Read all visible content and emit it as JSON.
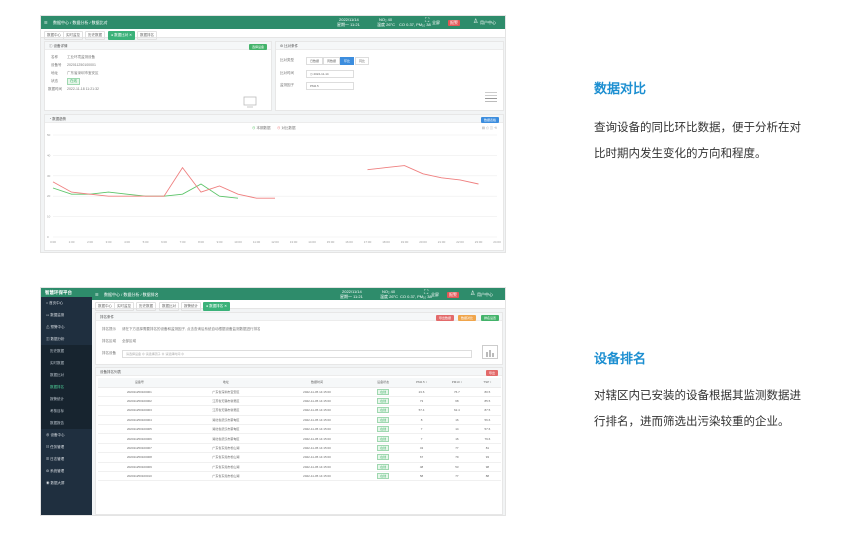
{
  "screen1": {
    "topbar": {
      "breadcrumb": "数据中心 / 数据分析 / 数据比对",
      "time1": "2022/11/14",
      "time2": "星期一 11:21",
      "metric1": "NO₂ 40",
      "metric2": "温度 26°C",
      "metric3": "CO 0.37, PM₁₀ 38",
      "fullscreen": "全屏",
      "alert": "报警",
      "user": "用户中心"
    },
    "tabs": [
      "数据中心",
      "实时监控",
      "历史数据",
      "数据比对",
      "数据排名"
    ],
    "active_tab": "数据比对",
    "device_panel": {
      "title": "设备详情",
      "button": "选择设备",
      "fields": [
        {
          "k": "名称",
          "v": "工业环境监测设备"
        },
        {
          "k": "设备号",
          "v": "202011250100001"
        },
        {
          "k": "地址",
          "v": "广东省深圳市宝安区"
        },
        {
          "k": "状态",
          "v": "在线"
        },
        {
          "k": "数据时间",
          "v": "2022-11-18 11:21:32"
        }
      ]
    },
    "compare_panel": {
      "title": "比对条件",
      "row1_label": "比对类型",
      "types": [
        "日数据",
        "周数据",
        "环比",
        "同比"
      ],
      "active_type": "环比",
      "row2_label": "比对时间",
      "date": "2022-11-14",
      "row3_label": "监测因子",
      "factor": "PM2.5",
      "legend_a": "本期数据",
      "legend_b": "对比数据"
    },
    "chart_panel": {
      "title": "数据趋势",
      "button": "数据表格"
    },
    "chart_data": {
      "type": "line",
      "title": "",
      "xlabel": "",
      "ylabel": "",
      "ylim": [
        0,
        50
      ],
      "yticks": [
        "50",
        "40",
        "30",
        "20",
        "10",
        "0"
      ],
      "x": [
        "0:00",
        "1:00",
        "2:00",
        "3:00",
        "4:00",
        "5:00",
        "6:00",
        "7:00",
        "8:00",
        "9:00",
        "10:00",
        "11:00",
        "12:00",
        "13:00",
        "14:00",
        "15:00",
        "16:00",
        "17:00",
        "18:00",
        "19:00",
        "20:00",
        "21:00",
        "22:00",
        "23:00",
        "24:00"
      ],
      "series": [
        {
          "name": "本期数据",
          "color": "#5cc469",
          "values": [
            24,
            21,
            21,
            22,
            21,
            20,
            20,
            21,
            26,
            20,
            19,
            null,
            null,
            null,
            null,
            null,
            null,
            null,
            null,
            null,
            null,
            null,
            null,
            null,
            null
          ]
        },
        {
          "name": "对比数据",
          "color": "#ef7f7f",
          "values": [
            27,
            22,
            21,
            20,
            20,
            20,
            20,
            34,
            22,
            25,
            21,
            19,
            19,
            null,
            null,
            null,
            null,
            33,
            34,
            35,
            31,
            29,
            28,
            26,
            null
          ]
        }
      ]
    }
  },
  "screen2": {
    "logo": "智慧环保平台",
    "topbar": {
      "breadcrumb": "数据中心 / 数据分析 / 数据排名",
      "time1": "2022/11/14",
      "time2": "星期一 11:21",
      "metric1": "NO₂ 40",
      "metric2": "温度 26°C",
      "metric3": "CO 0.37, PM₁₀ 38",
      "fullscreen": "全屏",
      "alert": "报警",
      "user": "用户中心"
    },
    "menu": [
      "首页中心",
      "数据监测",
      "预警中心",
      "数据分析"
    ],
    "submenu": [
      "历史数据",
      "实时数据",
      "数据比对",
      "数据排名",
      "报警统计",
      "考核目标",
      "数据报告"
    ],
    "active_submenu": "数据排名",
    "menu_bottom": [
      "设备中心",
      "任务管理",
      "日志管理",
      "系统管理",
      "数据大屏"
    ],
    "tabs": [
      "数据中心",
      "实时监控",
      "历史数据",
      "数据比对",
      "报警统计",
      "数据排名"
    ],
    "active_tab": "数据排名",
    "filter": {
      "title": "排名条件",
      "buttons": [
        "导出数据",
        "数据对比",
        "排名设置"
      ],
      "hint_label": "排名提示",
      "hint": "请在下方选择需要排名的设备和监测因子, 点击查询后系统自动根据设备监测数据进行排名",
      "area_label": "排名区域",
      "area": "全部区域",
      "device_label": "排名设备",
      "device_placeholder": "请选择设备 ⊗  请选择因子 ⊗  请选择时间 ⊗"
    },
    "table": {
      "title": "设备排名列表",
      "button": "导出",
      "headers": [
        "设备号",
        "地址",
        "数据时间",
        "设备状态",
        "PM2.5 ↕",
        "PM10 ↕",
        "TSP ↕"
      ],
      "rows": [
        [
          "202011250100001",
          "广东省深圳市宝安区",
          "2022-11-05 14:15:00",
          "在线",
          "23.6",
          "76.7",
          "80.5"
        ],
        [
          "202011250100002",
          "江苏省无锡市新吴区",
          "2022-11-05 14:15:00",
          "在线",
          "73",
          "68",
          "85.5"
        ],
        [
          "202011250100003",
          "江苏省无锡市新吴区",
          "2022-11-05 14:15:00",
          "在线",
          "57.4",
          "62.4",
          "87.5"
        ],
        [
          "202011250100004",
          "湖北省武汉市蔡甸区",
          "2022-11-05 14:15:00",
          "在线",
          "8",
          "16",
          "56.6"
        ],
        [
          "202011250100005",
          "湖北省武汉市蔡甸区",
          "2022-11-05 14:15:00",
          "在线",
          "7",
          "14",
          "57.6"
        ],
        [
          "202011250100006",
          "湖北省武汉市蔡甸区",
          "2022-11-05 14:15:00",
          "在线",
          "7",
          "16",
          "79.6"
        ],
        [
          "202011250100007",
          "广东省东莞市松山湖",
          "2022-11-05 14:15:00",
          "在线",
          "43",
          "77",
          "81"
        ],
        [
          "202011250100008",
          "广东省东莞市松山湖",
          "2022-11-05 14:15:00",
          "在线",
          "67",
          "79",
          "93"
        ],
        [
          "202011250100009",
          "广东省东莞市松山湖",
          "2022-11-05 14:15:00",
          "在线",
          "48",
          "53",
          "98"
        ],
        [
          "202011250100010",
          "广东省东莞市松山湖",
          "2022-11-05 14:15:00",
          "在线",
          "58",
          "77",
          "88"
        ]
      ]
    }
  },
  "sections": [
    {
      "title": "数据对比",
      "desc": "查询设备的同比环比数据，便于分析在对比时期内发生变化的方向和程度。"
    },
    {
      "title": "设备排名",
      "desc": "对辖区内已安装的设备根据其监测数据进行排名，进而筛选出污染较重的企业。"
    }
  ]
}
